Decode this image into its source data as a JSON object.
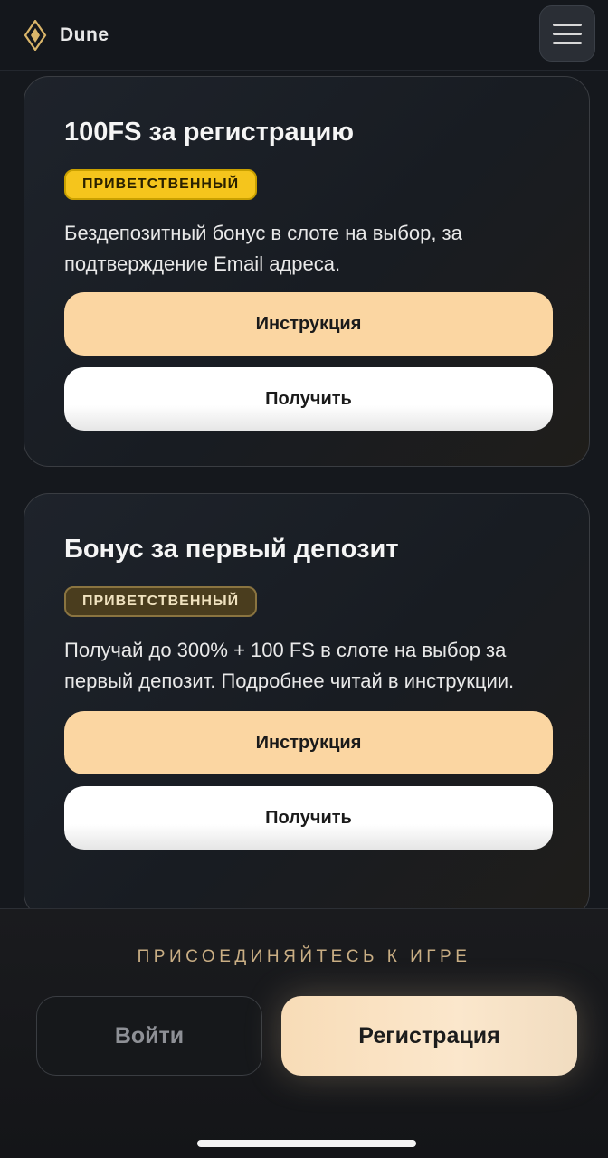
{
  "header": {
    "logo_text": "Dune",
    "logo_icon": "diamond-gem-icon",
    "menu_icon": "hamburger-menu-icon"
  },
  "cards": [
    {
      "title": "100FS за регистрацию",
      "badge": "ПРИВЕТСТВЕННЫЙ",
      "description": "Бездепозитный бонус в слоте на выбор, за подтверждение Email адреса.",
      "instruction_label": "Инструкция",
      "claim_label": "Получить"
    },
    {
      "title": "Бонус за первый депозит",
      "badge": "ПРИВЕТСТВЕННЫЙ",
      "description": "Получай до 300% + 100 FS в слоте на выбор за первый депозит. Подробнее читай в инструкции.",
      "instruction_label": "Инструкция",
      "claim_label": "Получить"
    }
  ],
  "join": {
    "title": "ПРИСОЕДИНЯЙТЕСЬ К ИГРЕ",
    "login_label": "Войти",
    "register_label": "Регистрация"
  },
  "colors": {
    "background": "#15181d",
    "accent_peach": "#fbd6a2",
    "badge_gold": "#f5c51c",
    "badge_dark": "#4a3d1e",
    "join_title": "#c9ae84"
  }
}
